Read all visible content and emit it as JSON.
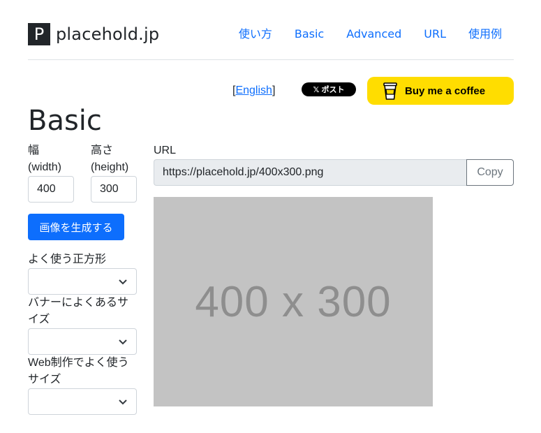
{
  "brand": {
    "logo_letter": "P",
    "name": "placehold.jp"
  },
  "nav": [
    "使い方",
    "Basic",
    "Advanced",
    "URL",
    "使用例"
  ],
  "lang": {
    "open": "[",
    "link": "English",
    "close": "]"
  },
  "x_post": {
    "label": "𝕏 ポスト"
  },
  "bmc": {
    "label": "Buy me a coffee"
  },
  "page": {
    "title": "Basic"
  },
  "form": {
    "width_label_1": "幅",
    "width_label_2": "(width)",
    "width_value": "400",
    "height_label_1": "高さ",
    "height_label_2": "(height)",
    "height_value": "300",
    "generate_label": "画像を生成する",
    "square_label": "よく使う正方形",
    "banner_label_1": "バナーによくあるサ",
    "banner_label_2": "イズ",
    "web_label_1": "Web制作でよく使う",
    "web_label_2": "サイズ"
  },
  "url": {
    "label": "URL",
    "value": "https://placehold.jp/400x300.png",
    "copy_label": "Copy"
  },
  "preview": {
    "text": "400 x 300"
  },
  "colors": {
    "primary": "#0d6efd",
    "bmc_yellow": "#FFDD00",
    "placeholder_bg": "#c3c3c3",
    "placeholder_text": "#8e8e8e"
  }
}
